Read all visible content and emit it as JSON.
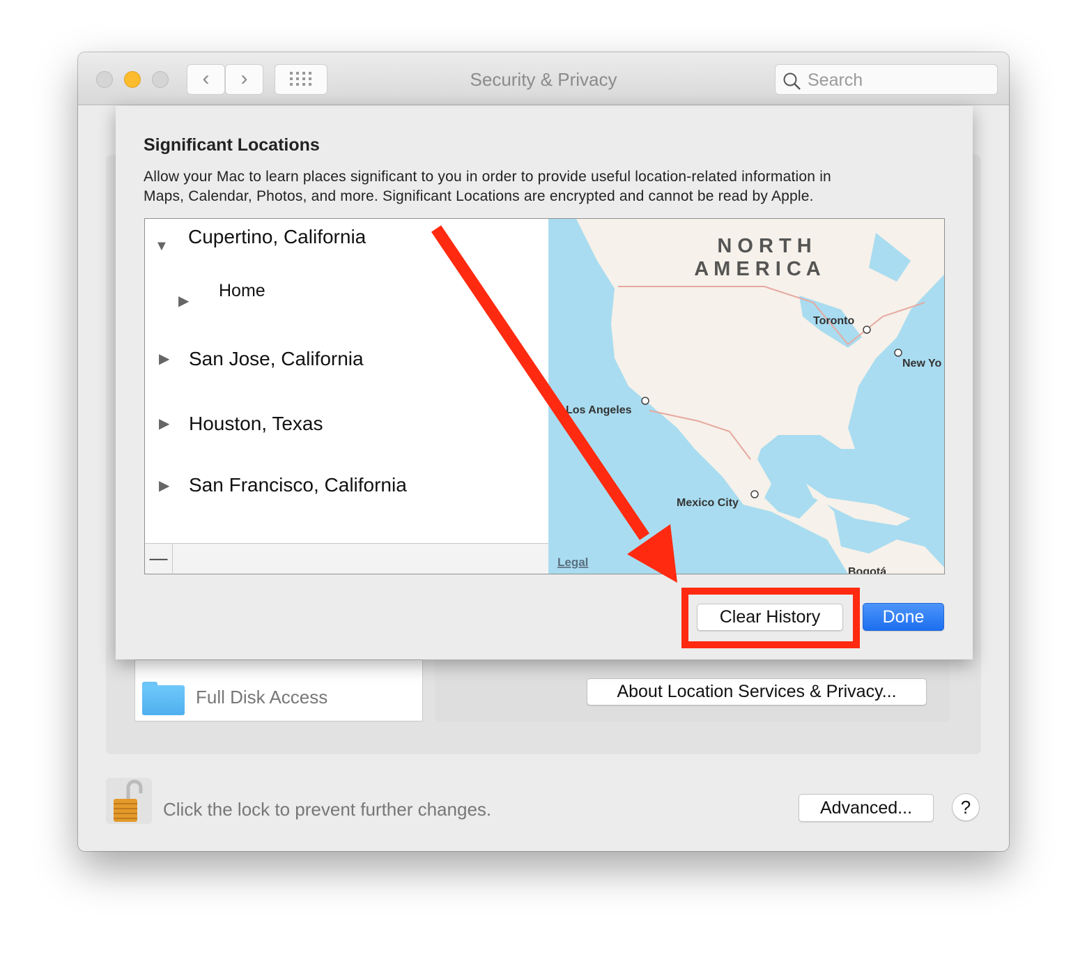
{
  "window": {
    "title": "Security & Privacy",
    "search_placeholder": "Search",
    "icons": {
      "back": "chevron-left-icon",
      "forward": "chevron-right-icon",
      "grid": "grid-icon",
      "search": "magnifier-icon"
    }
  },
  "sheet": {
    "heading": "Significant Locations",
    "description_line1": "Allow your Mac to learn places significant to you in order to provide useful location-related information in",
    "description_line2": "Maps, Calendar, Photos, and more. Significant Locations are encrypted and cannot be read by Apple.",
    "locations": [
      {
        "label": "Cupertino, California",
        "expanded": true,
        "children": [
          {
            "label": "Home"
          }
        ]
      },
      {
        "label": "San Jose, California",
        "expanded": false
      },
      {
        "label": "Houston, Texas",
        "expanded": false
      },
      {
        "label": "San Francisco, California",
        "expanded": false
      }
    ],
    "remove_label": "—",
    "map": {
      "region_line1": "N O R T H",
      "region_line2": "A M E R I C A",
      "cities": [
        "Toronto",
        "New Yo",
        "Los Angeles",
        "Mexico City",
        "Bogotá"
      ],
      "legal": "Legal",
      "colors": {
        "water": "#a9dcf0",
        "land": "#f6f1ea",
        "border": "#e6a9a0"
      }
    },
    "clear_history_label": "Clear History",
    "done_label": "Done"
  },
  "background": {
    "full_disk_access": "Full Disk Access",
    "about_button": "About Location Services & Privacy...",
    "lock_text": "Click the lock to prevent further changes.",
    "advanced_button": "Advanced...",
    "help_button": "?"
  },
  "annotation": {
    "color": "#ff2a10"
  },
  "colors": {
    "accent": "#1d6ff0",
    "minimize": "#fdbc2e"
  }
}
